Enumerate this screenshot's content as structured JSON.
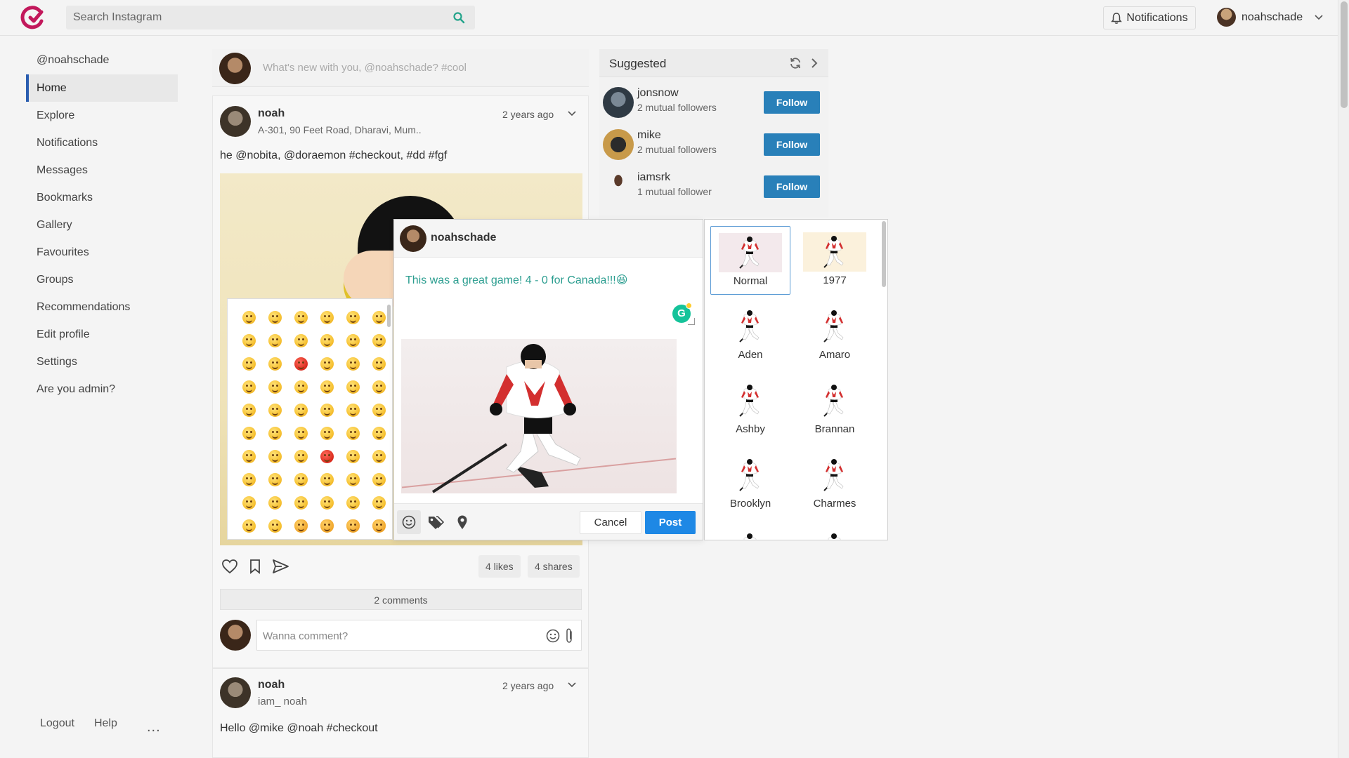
{
  "header": {
    "search_placeholder": "Search Instagram",
    "notifications_label": "Notifications",
    "username": "noahschade"
  },
  "leftnav": {
    "handle": "@noahschade",
    "items": [
      {
        "label": "Home",
        "active": true
      },
      {
        "label": "Explore"
      },
      {
        "label": "Notifications"
      },
      {
        "label": "Messages"
      },
      {
        "label": "Bookmarks"
      },
      {
        "label": "Gallery"
      },
      {
        "label": "Favourites"
      },
      {
        "label": "Groups"
      },
      {
        "label": "Recommendations"
      },
      {
        "label": "Edit profile"
      },
      {
        "label": "Settings"
      },
      {
        "label": "Are you admin?"
      }
    ],
    "bottom": {
      "logout": "Logout",
      "help": "Help",
      "more": "..."
    }
  },
  "composer": {
    "placeholder": "What's new with you, @noahschade? #cool"
  },
  "post1": {
    "author": "noah",
    "location": "A-301, 90 Feet Road, Dharavi, Mum..",
    "time": "2 years ago",
    "text": "he @nobita, @doraemon #checkout, #dd #fgf",
    "likes": "4 likes",
    "shares": "4 shares",
    "comments": "2 comments",
    "comment_placeholder": "Wanna comment?"
  },
  "post2": {
    "author": "noah",
    "location": "iam_ noah",
    "time": "2 years ago",
    "text": "Hello @mike @noah #checkout"
  },
  "suggested": {
    "title": "Suggested",
    "users": [
      {
        "name": "jonsnow",
        "mutual": "2 mutual followers",
        "button": "Follow"
      },
      {
        "name": "mike",
        "mutual": "2 mutual followers",
        "button": "Follow"
      },
      {
        "name": "iamsrk",
        "mutual": "1 mutual follower",
        "button": "Follow"
      }
    ]
  },
  "dialog": {
    "username": "noahschade",
    "text": "This was a great game! 4 - 0 for Canada!!!😆",
    "cancel": "Cancel",
    "post": "Post"
  },
  "filters": [
    {
      "label": "Normal",
      "selected": true
    },
    {
      "label": "1977"
    },
    {
      "label": "Aden"
    },
    {
      "label": "Amaro"
    },
    {
      "label": "Ashby"
    },
    {
      "label": "Brannan"
    },
    {
      "label": "Brooklyn"
    },
    {
      "label": "Charmes"
    }
  ],
  "colors": {
    "accent": "#2980b9",
    "post_button": "#1e88e5",
    "brand": "#c2185b",
    "dialog_text": "#2a9d8f"
  }
}
